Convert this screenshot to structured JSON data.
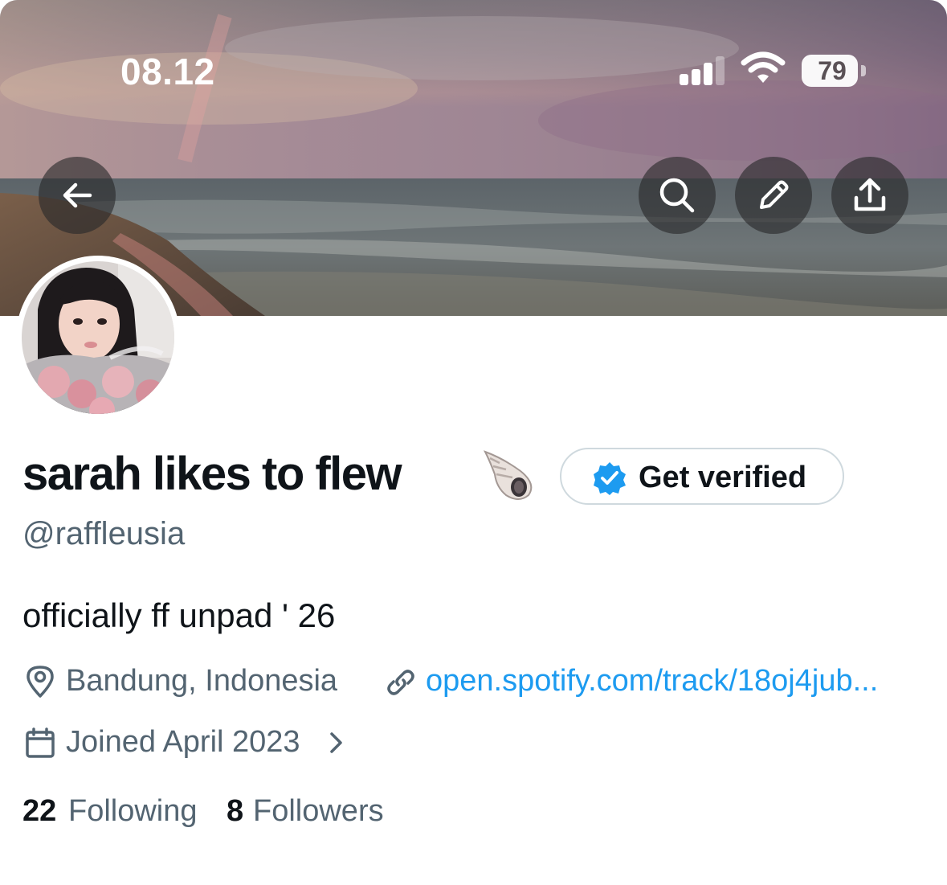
{
  "status_bar": {
    "time": "08.12",
    "battery": "79",
    "icons": [
      "signal-icon",
      "wifi-icon",
      "battery-icon"
    ]
  },
  "header": {
    "buttons": [
      {
        "name": "back-button",
        "icon": "arrow-left-icon"
      },
      {
        "name": "search-button",
        "icon": "search-icon"
      },
      {
        "name": "edit-button",
        "icon": "pencil-icon"
      },
      {
        "name": "share-button",
        "icon": "share-icon"
      }
    ]
  },
  "profile": {
    "display_name": "sarah likes to flew",
    "name_emoji": "spiral-shell-icon",
    "handle": "@raffleusia",
    "verify_label": "Get verified",
    "bio": "officially ff unpad ' 26",
    "location": "Bandung, Indonesia",
    "website": "open.spotify.com/track/18oj4jub...",
    "joined": "Joined April 2023",
    "following_count": "22",
    "following_label": "Following",
    "followers_count": "8",
    "followers_label": "Followers"
  },
  "colors": {
    "text": "#0f1419",
    "secondary": "#536471",
    "link": "#1d9bf0",
    "verified_badge": "#1d9bf0"
  }
}
